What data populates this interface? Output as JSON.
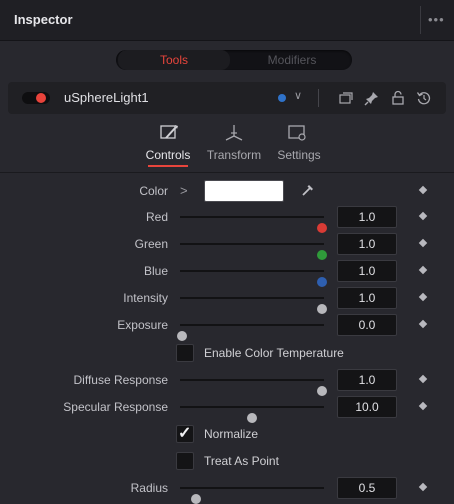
{
  "panel": {
    "title": "Inspector",
    "more_label": "•••"
  },
  "tabs": {
    "tools_label": "Tools",
    "modifiers_label": "Modifiers",
    "active": "Tools"
  },
  "node": {
    "name": "uSphereLight1",
    "enabled": true,
    "color_label": "#2f72c9"
  },
  "modes": [
    {
      "label": "Controls",
      "icon": "controls-icon",
      "active": true
    },
    {
      "label": "Transform",
      "icon": "transform-icon",
      "active": false
    },
    {
      "label": "Settings",
      "icon": "settings-icon",
      "active": false
    }
  ],
  "controls": {
    "color": {
      "label": "Color",
      "swatch": "#ffffff"
    },
    "red": {
      "label": "Red",
      "value": "1.0",
      "fraction": 1.0,
      "knob_color": "#d93b35"
    },
    "green": {
      "label": "Green",
      "value": "1.0",
      "fraction": 1.0,
      "knob_color": "#2f9a3a"
    },
    "blue": {
      "label": "Blue",
      "value": "1.0",
      "fraction": 1.0,
      "knob_color": "#2e5fb0"
    },
    "intensity": {
      "label": "Intensity",
      "value": "1.0",
      "fraction": 1.0,
      "knob_color": "#b8b8bc"
    },
    "exposure": {
      "label": "Exposure",
      "value": "0.0",
      "fraction": 0.0,
      "knob_color": "#b8b8bc"
    },
    "enable_color_temperature": {
      "label": "Enable Color Temperature",
      "checked": false
    },
    "diffuse_response": {
      "label": "Diffuse Response",
      "value": "1.0",
      "fraction": 1.0,
      "knob_color": "#b8b8bc"
    },
    "specular_response": {
      "label": "Specular Response",
      "value": "10.0",
      "fraction": 0.5,
      "knob_color": "#b8b8bc"
    },
    "normalize": {
      "label": "Normalize",
      "checked": true
    },
    "treat_as_point": {
      "label": "Treat As Point",
      "checked": false
    },
    "radius": {
      "label": "Radius",
      "value": "0.5",
      "fraction": 0.1,
      "knob_color": "#b8b8bc"
    }
  }
}
